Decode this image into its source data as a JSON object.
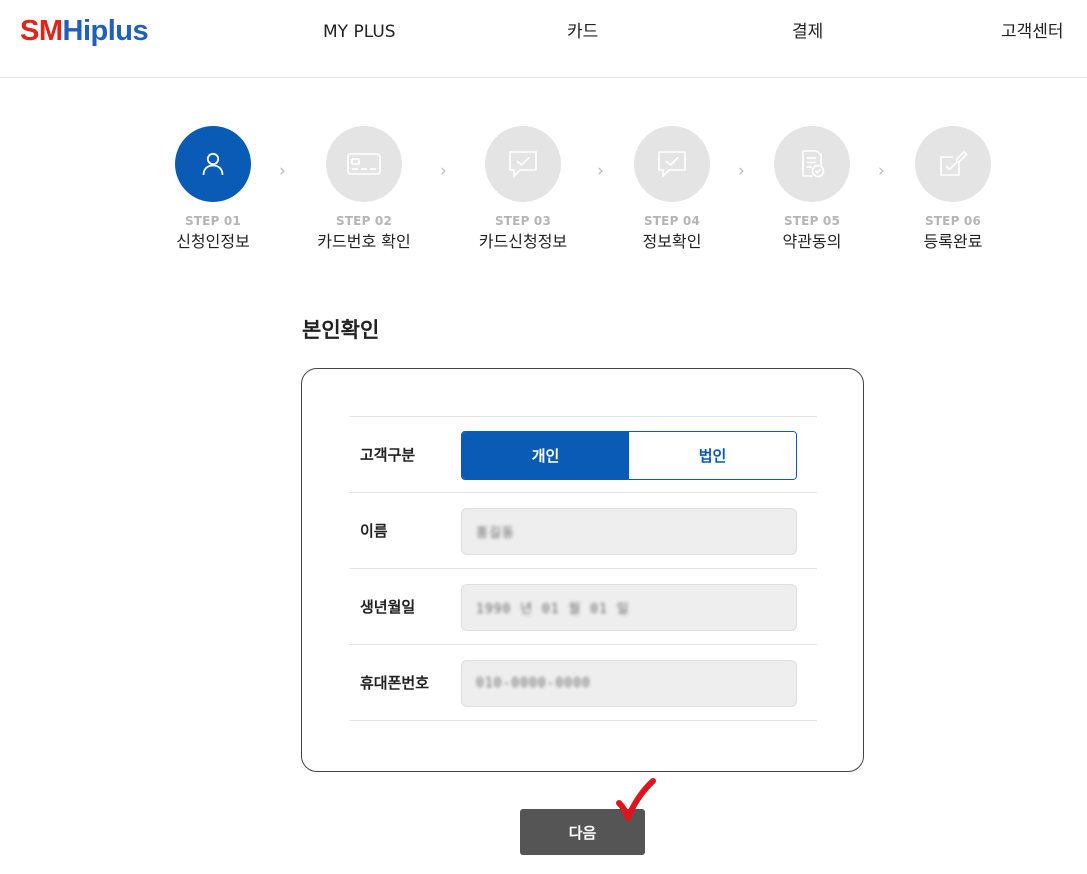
{
  "header": {
    "logo_part1": "SM",
    "logo_part2": "Hiplus",
    "nav": [
      "MY PLUS",
      "카드",
      "결제",
      "고객센터"
    ]
  },
  "steps": [
    {
      "num": "STEP 01",
      "label": "신청인정보",
      "icon": "user-icon",
      "active": true
    },
    {
      "num": "STEP 02",
      "label": "카드번호 확인",
      "icon": "card-icon",
      "active": false
    },
    {
      "num": "STEP 03",
      "label": "카드신청정보",
      "icon": "chat-check-icon",
      "active": false
    },
    {
      "num": "STEP 04",
      "label": "정보확인",
      "icon": "chat-check-icon",
      "active": false
    },
    {
      "num": "STEP 05",
      "label": "약관동의",
      "icon": "document-check-icon",
      "active": false
    },
    {
      "num": "STEP 06",
      "label": "등록완료",
      "icon": "edit-check-icon",
      "active": false
    }
  ],
  "section_title": "본인확인",
  "form": {
    "customer_type_label": "고객구분",
    "customer_type_options": [
      "개인",
      "법인"
    ],
    "customer_type_selected": "개인",
    "name_label": "이름",
    "name_value": "홍길동",
    "birth_label": "생년월일",
    "birth_value": "1990 년 01 월 01 일",
    "phone_label": "휴대폰번호",
    "phone_value": "010-0000-0000"
  },
  "next_button": "다음",
  "colors": {
    "accent": "#0a5bb5",
    "logo_red": "#e2231a",
    "logo_blue": "#1f5fbf",
    "button_dark": "#555555",
    "annotation_check": "#e0141e"
  }
}
